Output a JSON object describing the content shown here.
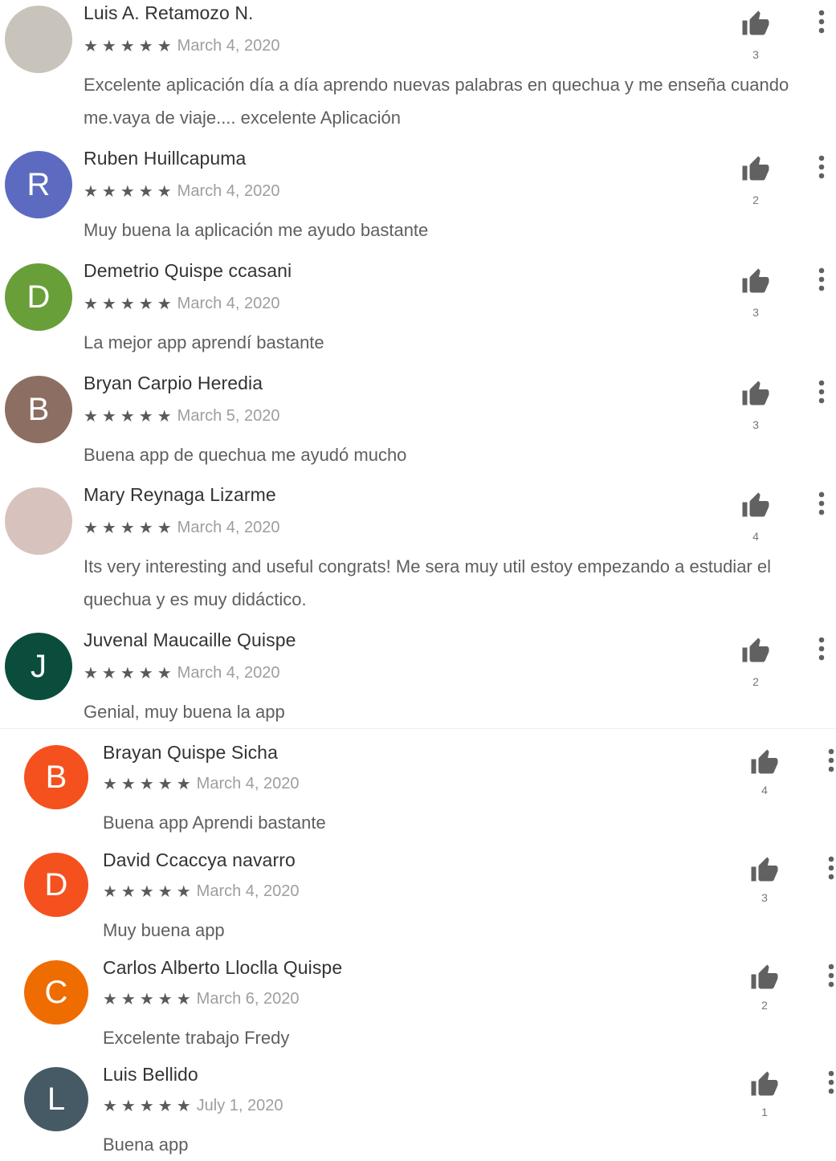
{
  "reviews": [
    {
      "name": "Luis A. Retamozo N.",
      "stars": "★★★★★",
      "date": "March 4, 2020",
      "text": "Excelente aplicación día a día aprendo nuevas palabras en quechua y me enseña cuando me.vaya de viaje.... excelente Aplicación",
      "likes": "3",
      "avatar_letter": "",
      "avatar_color": "#c9c4bb"
    },
    {
      "name": "Ruben Huillcapuma",
      "stars": "★★★★★",
      "date": "March 4, 2020",
      "text": "Muy buena la aplicación me ayudo bastante",
      "likes": "2",
      "avatar_letter": "R",
      "avatar_color": "#5c6bc0"
    },
    {
      "name": "Demetrio Quispe ccasani",
      "stars": "★★★★★",
      "date": "March 4, 2020",
      "text": "La mejor app aprendí bastante",
      "likes": "3",
      "avatar_letter": "D",
      "avatar_color": "#689f38"
    },
    {
      "name": "Bryan Carpio Heredia",
      "stars": "★★★★★",
      "date": "March 5, 2020",
      "text": "Buena app de quechua me ayudó mucho",
      "likes": "3",
      "avatar_letter": "B",
      "avatar_color": "#8d6e63"
    },
    {
      "name": "Mary Reynaga Lizarme",
      "stars": "★★★★★",
      "date": "March 4, 2020",
      "text": "Its very interesting and useful congrats! Me sera muy util estoy empezando a estudiar el quechua y es muy didáctico.",
      "likes": "4",
      "avatar_letter": "",
      "avatar_color": "#d8c2bd"
    },
    {
      "name": "Juvenal Maucaille Quispe",
      "stars": "★★★★★",
      "date": "March 4, 2020",
      "text": "Genial, muy buena la app",
      "likes": "2",
      "avatar_letter": "J",
      "avatar_color": "#0b4d3c"
    },
    {
      "name": "Brayan Quispe Sicha",
      "stars": "★★★★★",
      "date": "March 4, 2020",
      "text": "Buena app Aprendi bastante",
      "likes": "4",
      "avatar_letter": "B",
      "avatar_color": "#f4511e"
    },
    {
      "name": "David Ccaccya navarro",
      "stars": "★★★★★",
      "date": "March 4, 2020",
      "text": "Muy buena app",
      "likes": "3",
      "avatar_letter": "D",
      "avatar_color": "#f4511e"
    },
    {
      "name": "Carlos Alberto Lloclla Quispe",
      "stars": "★★★★★",
      "date": "March 6, 2020",
      "text": "Excelente trabajo Fredy",
      "likes": "2",
      "avatar_letter": "C",
      "avatar_color": "#ef6c00"
    },
    {
      "name": "Luis Bellido",
      "stars": "★★★★★",
      "date": "July 1, 2020",
      "text": "Buena app",
      "likes": "1",
      "avatar_letter": "L",
      "avatar_color": "#455a64"
    }
  ]
}
